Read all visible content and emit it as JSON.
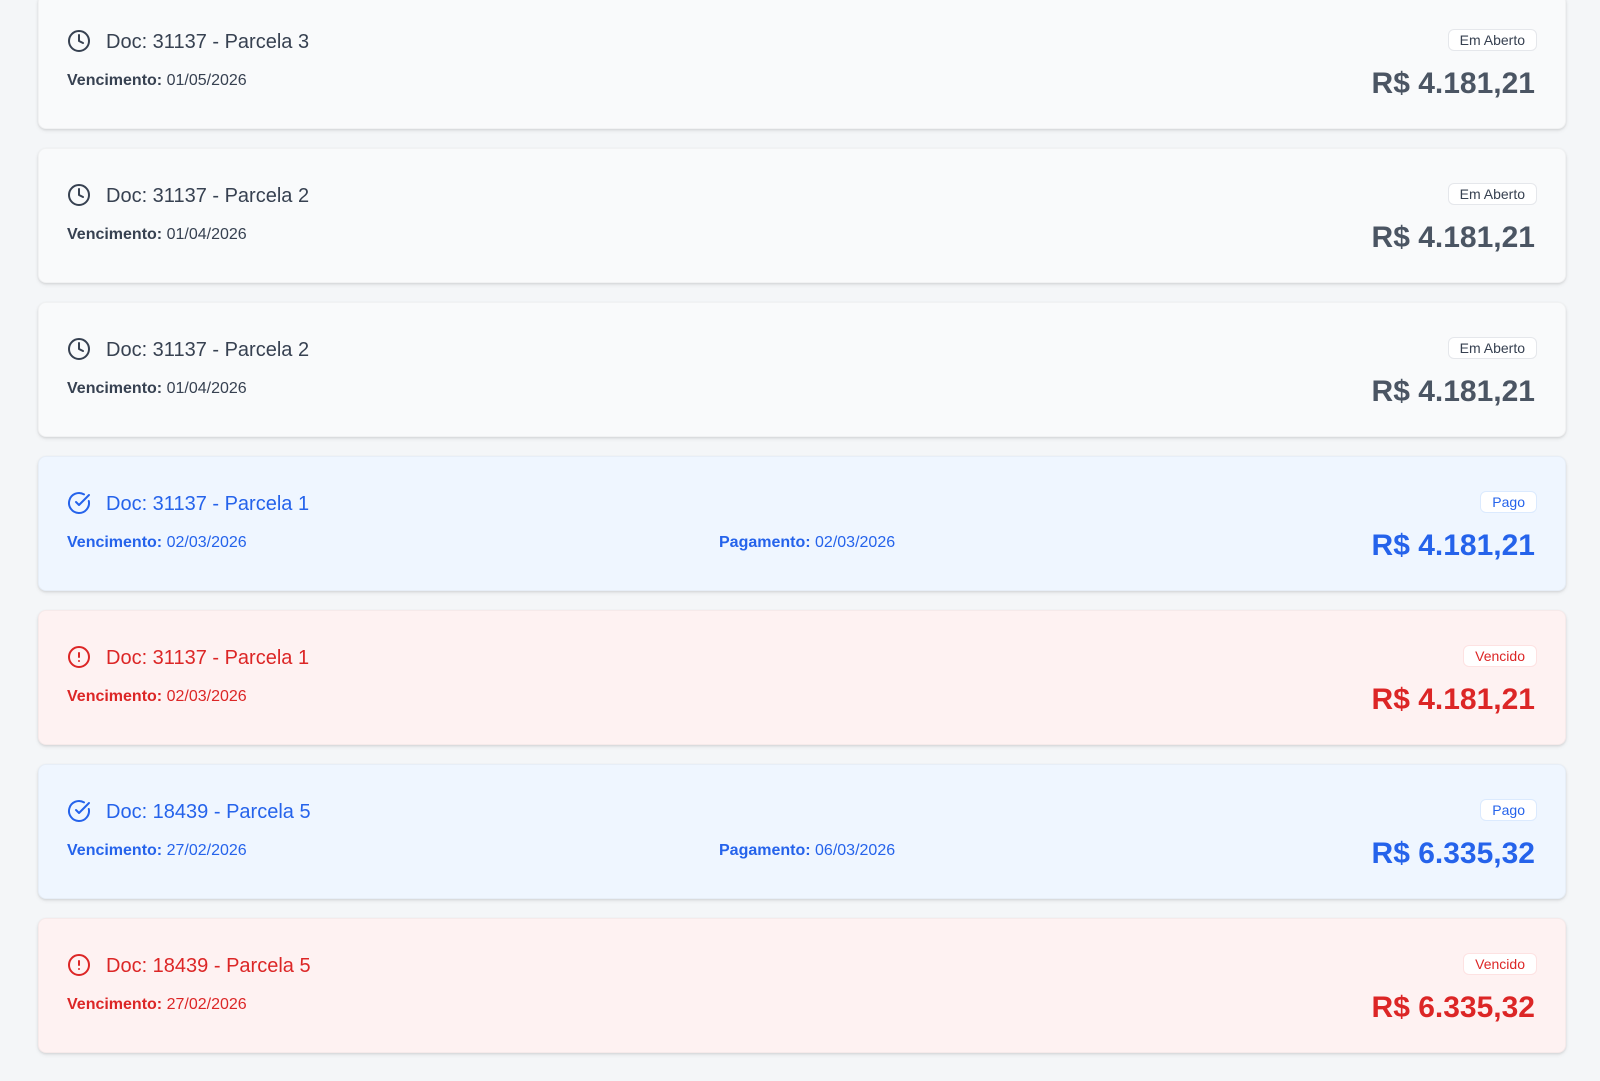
{
  "colors": {
    "open_text": "#374151",
    "paid_text": "#2563eb",
    "overdue_text": "#dc2626",
    "open_bg": "#f9fafb",
    "paid_bg": "#eff6ff",
    "overdue_bg": "#fef2f2"
  },
  "labels": {
    "due": "Vencimento:",
    "payment": "Pagamento:"
  },
  "items": [
    {
      "status": "open",
      "icon": "clock-icon",
      "title": "Doc: 31137 - Parcela 3",
      "due": "01/05/2026",
      "payment": null,
      "badge": "Em Aberto",
      "amount": "R$ 4.181,21"
    },
    {
      "status": "open",
      "icon": "clock-icon",
      "title": "Doc: 31137 - Parcela 2",
      "due": "01/04/2026",
      "payment": null,
      "badge": "Em Aberto",
      "amount": "R$ 4.181,21"
    },
    {
      "status": "open",
      "icon": "clock-icon",
      "title": "Doc: 31137 - Parcela 2",
      "due": "01/04/2026",
      "payment": null,
      "badge": "Em Aberto",
      "amount": "R$ 4.181,21"
    },
    {
      "status": "paid",
      "icon": "check-circle-icon",
      "title": "Doc: 31137 - Parcela 1",
      "due": "02/03/2026",
      "payment": "02/03/2026",
      "badge": "Pago",
      "amount": "R$ 4.181,21"
    },
    {
      "status": "overdue",
      "icon": "alert-circle-icon",
      "title": "Doc: 31137 - Parcela 1",
      "due": "02/03/2026",
      "payment": null,
      "badge": "Vencido",
      "amount": "R$ 4.181,21"
    },
    {
      "status": "paid",
      "icon": "check-circle-icon",
      "title": "Doc: 18439 - Parcela 5",
      "due": "27/02/2026",
      "payment": "06/03/2026",
      "badge": "Pago",
      "amount": "R$ 6.335,32"
    },
    {
      "status": "overdue",
      "icon": "alert-circle-icon",
      "title": "Doc: 18439 - Parcela 5",
      "due": "27/02/2026",
      "payment": null,
      "badge": "Vencido",
      "amount": "R$ 6.335,32"
    }
  ]
}
